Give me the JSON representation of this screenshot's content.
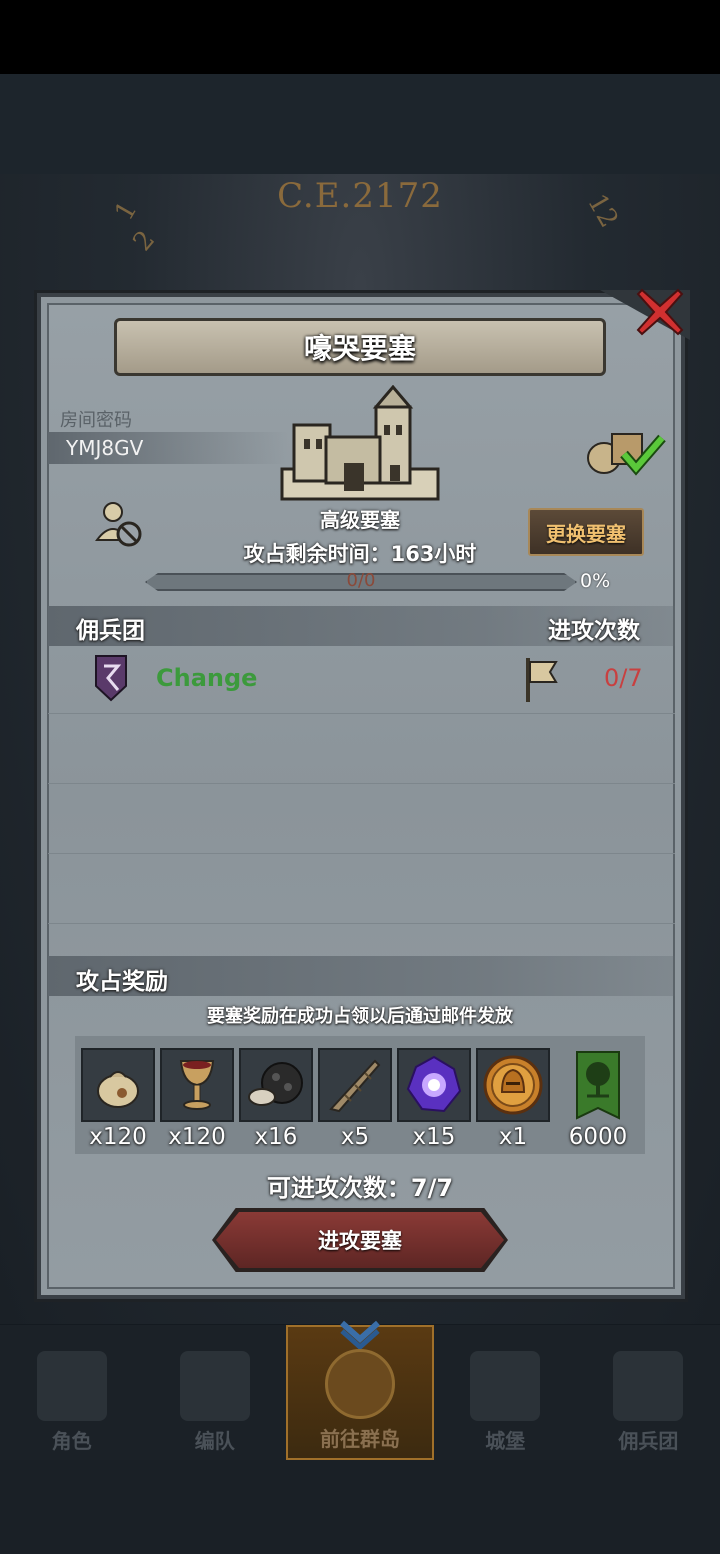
{
  "background": {
    "year": "C.E.2172",
    "dial_numbers": [
      "1",
      "2",
      "12"
    ]
  },
  "dialog": {
    "title": "嚎哭要塞",
    "room": {
      "label": "房间密码",
      "code": "YMJ8GV"
    },
    "fortress": {
      "grade": "高级要塞",
      "change_button": "更换要塞",
      "remaining_time": "攻占剩余时间：163小时"
    },
    "progress": {
      "text": "0/0",
      "percent_label": "0%",
      "fill": 0
    },
    "mercenary_section": {
      "label": "佣兵团",
      "attacks_label": "进攻次数",
      "rows": [
        {
          "name": "Change",
          "attacks": "0/7"
        }
      ]
    },
    "rewards": {
      "label": "攻占奖励",
      "note": "要塞奖励在成功占领以后通过邮件发放",
      "items": [
        {
          "icon": "sack-icon",
          "qty": "x120"
        },
        {
          "icon": "goblet-icon",
          "qty": "x120"
        },
        {
          "icon": "ore-icon",
          "qty": "x16"
        },
        {
          "icon": "horn-icon",
          "qty": "x5"
        },
        {
          "icon": "purple-crystal-icon",
          "qty": "x15"
        },
        {
          "icon": "golden-helmet-coin-icon",
          "qty": "x1"
        },
        {
          "icon": "tree-banner-icon",
          "qty": "6000"
        }
      ]
    },
    "attack_count": "可进攻次数：7/7",
    "attack_button": "进攻要塞"
  },
  "bottom_nav": [
    {
      "label": "角色",
      "icon": "knight-icon"
    },
    {
      "label": "编队",
      "icon": "formation-icon"
    },
    {
      "label": "前往群岛",
      "icon": "islands-map-icon",
      "active": true
    },
    {
      "label": "城堡",
      "icon": "castle-icon"
    },
    {
      "label": "佣兵团",
      "icon": "mercenary-icon"
    }
  ],
  "colors": {
    "accent_gold": "#f0c070",
    "mercenary_name": "#3c9a3c",
    "attack_count": "#c84040",
    "attack_button": "#8a3a36",
    "close_icon": "#d03030"
  }
}
